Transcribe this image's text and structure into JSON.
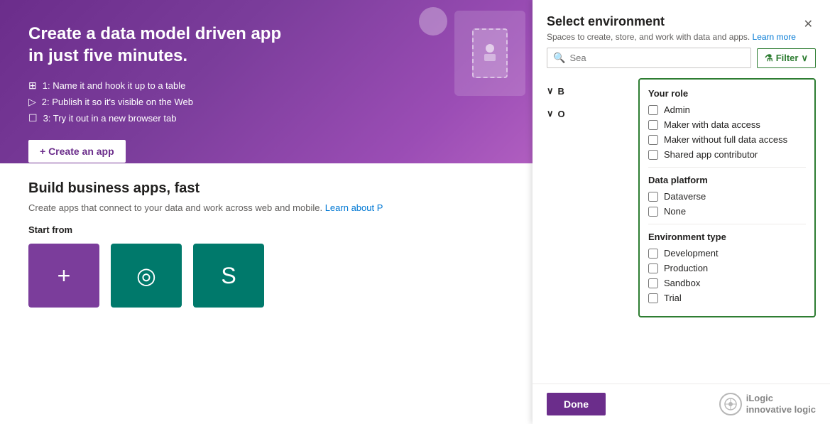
{
  "hero": {
    "title": "Create a data model driven app in just five minutes.",
    "steps": [
      {
        "icon": "⊞",
        "text": "1: Name it and hook it up to a table"
      },
      {
        "icon": "▷",
        "text": "2: Publish it so it's visible on the Web"
      },
      {
        "icon": "☐",
        "text": "3: Try it out in a new browser tab"
      }
    ],
    "create_btn": "+ Create an app"
  },
  "build": {
    "title": "Build business apps, fast",
    "description": "Create apps that connect to your data and work across web and mobile.",
    "learn_link": "Learn about P",
    "start_from": "Start from"
  },
  "panel": {
    "title": "Select environment",
    "subtitle": "Spaces to create, store, and work with data and apps.",
    "learn_more": "Learn more",
    "close_icon": "✕",
    "search_placeholder": "Sea",
    "filter_label": "Filter",
    "filter_chevron": "∨",
    "filter_icon": "⚗"
  },
  "filter_dropdown": {
    "your_role_title": "Your role",
    "roles": [
      {
        "id": "admin",
        "label": "Admin",
        "checked": false
      },
      {
        "id": "maker-with-data",
        "label": "Maker with data access",
        "checked": false
      },
      {
        "id": "maker-without-data",
        "label": "Maker without full data access",
        "checked": false
      },
      {
        "id": "shared-app",
        "label": "Shared app contributor",
        "checked": false
      }
    ],
    "data_platform_title": "Data platform",
    "data_platforms": [
      {
        "id": "dataverse",
        "label": "Dataverse",
        "checked": false
      },
      {
        "id": "none",
        "label": "None",
        "checked": false
      }
    ],
    "env_type_title": "Environment type",
    "env_types": [
      {
        "id": "development",
        "label": "Development",
        "checked": false
      },
      {
        "id": "production",
        "label": "Production",
        "checked": false
      },
      {
        "id": "sandbox",
        "label": "Sandbox",
        "checked": false
      },
      {
        "id": "trial",
        "label": "Trial",
        "checked": false
      }
    ]
  },
  "env_groups": [
    {
      "label": "B",
      "expanded": true,
      "items": []
    },
    {
      "label": "O",
      "expanded": true,
      "items": []
    }
  ],
  "done_button": "Done",
  "logo": {
    "text": "innovative logic",
    "brand": "iLogic"
  }
}
